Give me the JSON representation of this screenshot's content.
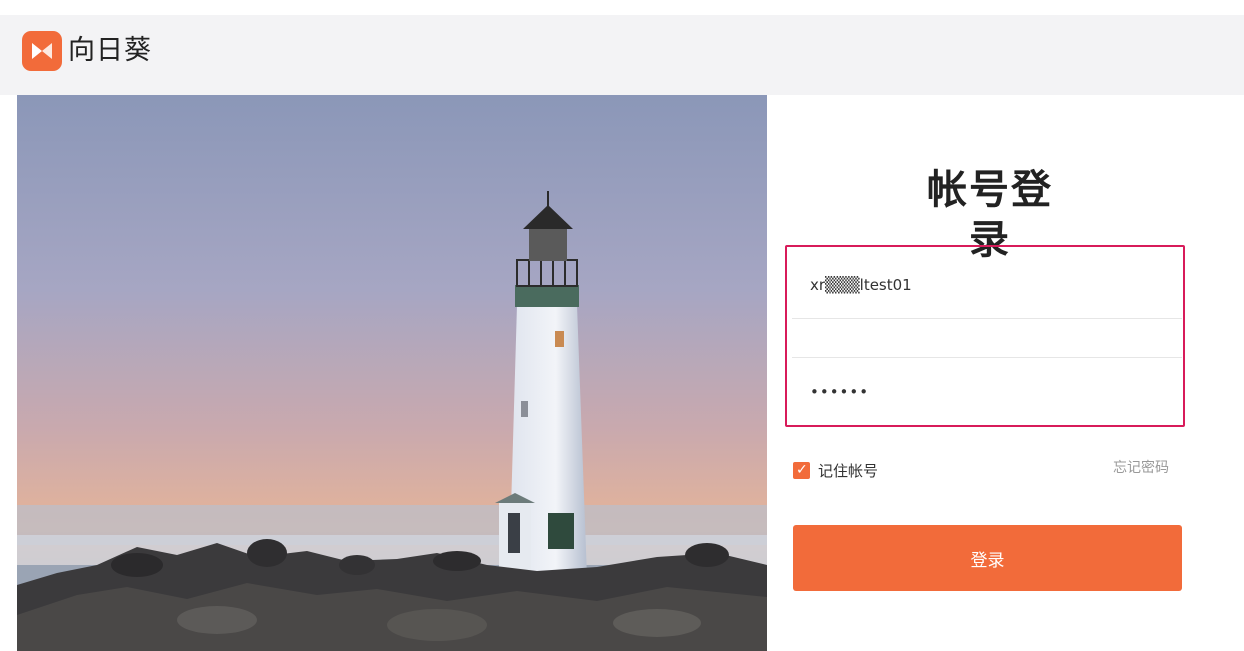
{
  "brand": {
    "name": "向日葵",
    "accent": "#f26b3a"
  },
  "hero": {
    "subject": "lighthouse-photo"
  },
  "login": {
    "title": "帐号登录",
    "username_value": "xr▒▒▒ltest01",
    "password_value": "••••••",
    "remember_label": "记住帐号",
    "remember_checked": true,
    "forgot_label": "忘记密码",
    "submit_label": "登录",
    "highlight_color": "#d81b5a"
  }
}
